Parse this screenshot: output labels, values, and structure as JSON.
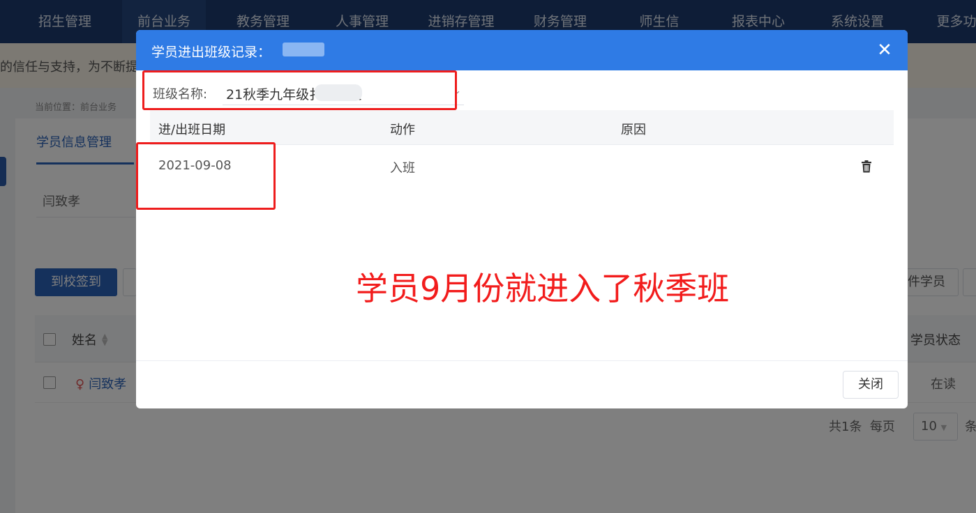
{
  "nav": {
    "items": [
      "招生管理",
      "前台业务",
      "教务管理",
      "人事管理",
      "进销存管理",
      "财务管理",
      "师生信",
      "报表中心",
      "系统设置",
      "更多功"
    ]
  },
  "notice": {
    "text": "的信任与支持，为不断提"
  },
  "breadcrumb": {
    "text": "当前位置：前台业务"
  },
  "page": {
    "tab_active": "学员信息管理",
    "search_name": "闫致孝",
    "btn_checkin": "到校签到",
    "btn_right": "件学员",
    "table": {
      "col_name": "姓名",
      "col_status": "学员状态",
      "rows": [
        {
          "name": "闫致孝",
          "gender": "♀",
          "status": "在读"
        }
      ]
    },
    "pager": {
      "total": "共1条",
      "per_page_label": "每页",
      "per_page": "10",
      "tail": "条"
    }
  },
  "modal": {
    "title": "学员进出班级记录：",
    "class_label": "班级名称:",
    "class_value": "21秋季九年级扌笃  2班",
    "columns": [
      "进/出班日期",
      "动作",
      "原因"
    ],
    "rows": [
      {
        "date": "2021-09-08",
        "action": "入班",
        "reason": ""
      }
    ],
    "annotation": "学员9月份就进入了秋季班",
    "close_button": "关闭"
  },
  "colors": {
    "nav_bg": "#1d3b6e",
    "modal_header": "#2f7be5",
    "primary": "#2a62b8",
    "annotation": "#f21c1c"
  }
}
